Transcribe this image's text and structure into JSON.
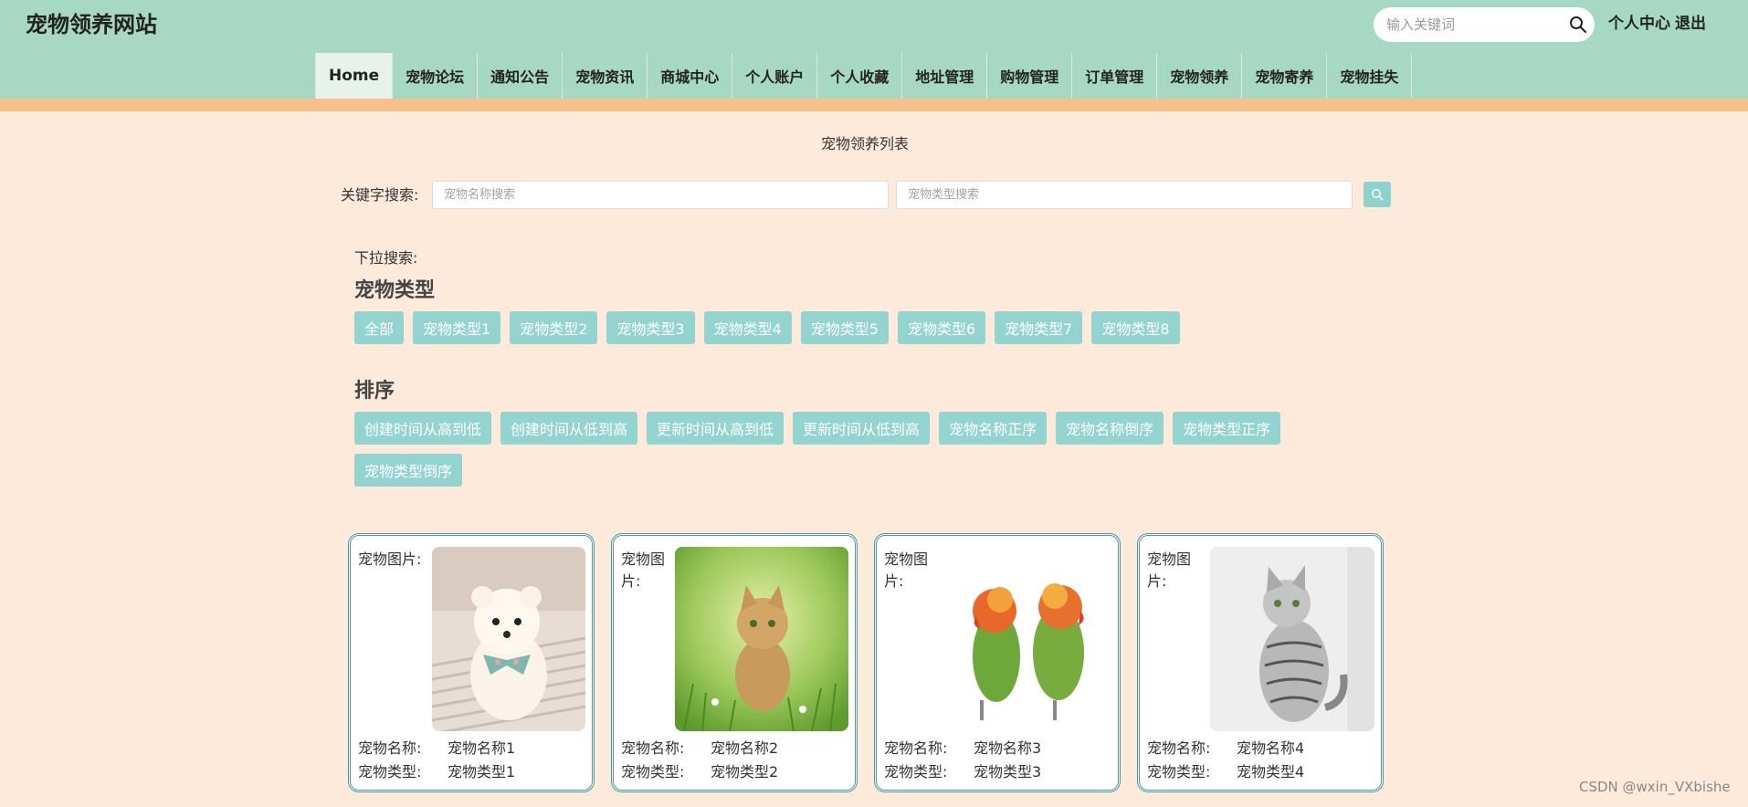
{
  "header": {
    "site_title": "宠物领养网站",
    "search_placeholder": "输入关键词",
    "personal_center": "个人中心",
    "logout": "退出"
  },
  "nav": [
    {
      "label": "Home",
      "active": true
    },
    {
      "label": "宠物论坛"
    },
    {
      "label": "通知公告"
    },
    {
      "label": "宠物资讯"
    },
    {
      "label": "商城中心"
    },
    {
      "label": "个人账户"
    },
    {
      "label": "个人收藏"
    },
    {
      "label": "地址管理"
    },
    {
      "label": "购物管理"
    },
    {
      "label": "订单管理"
    },
    {
      "label": "宠物领养"
    },
    {
      "label": "宠物寄养"
    },
    {
      "label": "宠物挂失"
    }
  ],
  "main": {
    "list_title": "宠物领养列表",
    "keyword_label": "关键字搜索:",
    "name_placeholder": "宠物名称搜索",
    "type_placeholder": "宠物类型搜索",
    "dropdown_label": "下拉搜索:",
    "pet_type_title": "宠物类型",
    "pet_types": [
      "全部",
      "宠物类型1",
      "宠物类型2",
      "宠物类型3",
      "宠物类型4",
      "宠物类型5",
      "宠物类型6",
      "宠物类型7",
      "宠物类型8"
    ],
    "sort_title": "排序",
    "sort_options": [
      "创建时间从高到低",
      "创建时间从低到高",
      "更新时间从高到低",
      "更新时间从低到高",
      "宠物名称正序",
      "宠物名称倒序",
      "宠物类型正序",
      "宠物类型倒序"
    ]
  },
  "cards": [
    {
      "image_label": "宠物图片:",
      "image": "pomeranian-dog-photo",
      "name_label": "宠物名称:",
      "name": "宠物名称1",
      "type_label": "宠物类型:",
      "type": "宠物类型1"
    },
    {
      "image_label": "宠物图片:",
      "image": "kitten-in-grass-photo",
      "name_label": "宠物名称:",
      "name": "宠物名称2",
      "type_label": "宠物类型:",
      "type": "宠物类型2"
    },
    {
      "image_label": "宠物图片:",
      "image": "lovebird-parrots-photo",
      "name_label": "宠物名称:",
      "name": "宠物名称3",
      "type_label": "宠物类型:",
      "type": "宠物类型3"
    },
    {
      "image_label": "宠物图片:",
      "image": "tabby-cat-photo",
      "name_label": "宠物名称:",
      "name": "宠物名称4",
      "type_label": "宠物类型:",
      "type": "宠物类型4"
    }
  ],
  "watermark": "CSDN @wxin_VXbishe",
  "colors": {
    "header_bg": "#a7d8c4",
    "accent_strip": "#f6c18b",
    "page_bg": "#fdeadb",
    "chip_bg": "#93d3d0",
    "card_border": "#4a9aa6"
  }
}
